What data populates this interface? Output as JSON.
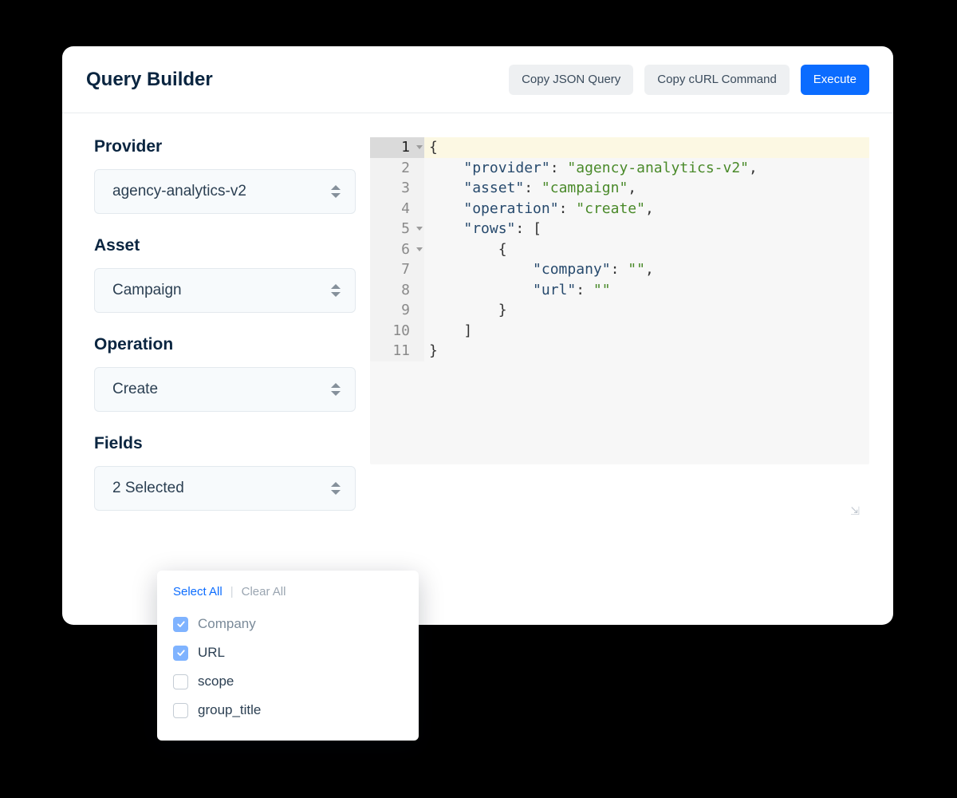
{
  "header": {
    "title": "Query Builder",
    "copy_json": "Copy JSON Query",
    "copy_curl": "Copy cURL Command",
    "execute": "Execute"
  },
  "form": {
    "provider_label": "Provider",
    "provider_value": "agency-analytics-v2",
    "asset_label": "Asset",
    "asset_value": "Campaign",
    "operation_label": "Operation",
    "operation_value": "Create",
    "fields_label": "Fields",
    "fields_value": "2 Selected"
  },
  "dropdown": {
    "select_all": "Select All",
    "clear_all": "Clear All",
    "options": [
      {
        "label": "Company",
        "checked": true,
        "muted": true
      },
      {
        "label": "URL",
        "checked": true,
        "muted": false
      },
      {
        "label": "scope",
        "checked": false,
        "muted": false
      },
      {
        "label": "group_title",
        "checked": false,
        "muted": false
      }
    ]
  },
  "editor": {
    "lines": [
      {
        "n": "1",
        "fold": true,
        "active": true,
        "tokens": [
          [
            "p",
            "{"
          ]
        ]
      },
      {
        "n": "2",
        "fold": false,
        "tokens": [
          [
            "ws",
            "    "
          ],
          [
            "key",
            "\"provider\""
          ],
          [
            "colon",
            ": "
          ],
          [
            "str",
            "\"agency-analytics-v2\""
          ],
          [
            "p",
            ","
          ]
        ]
      },
      {
        "n": "3",
        "fold": false,
        "tokens": [
          [
            "ws",
            "    "
          ],
          [
            "key",
            "\"asset\""
          ],
          [
            "colon",
            ": "
          ],
          [
            "str",
            "\"campaign\""
          ],
          [
            "p",
            ","
          ]
        ]
      },
      {
        "n": "4",
        "fold": false,
        "tokens": [
          [
            "ws",
            "    "
          ],
          [
            "key",
            "\"operation\""
          ],
          [
            "colon",
            ": "
          ],
          [
            "str",
            "\"create\""
          ],
          [
            "p",
            ","
          ]
        ]
      },
      {
        "n": "5",
        "fold": true,
        "tokens": [
          [
            "ws",
            "    "
          ],
          [
            "key",
            "\"rows\""
          ],
          [
            "colon",
            ": "
          ],
          [
            "p",
            "["
          ]
        ]
      },
      {
        "n": "6",
        "fold": true,
        "tokens": [
          [
            "ws",
            "        "
          ],
          [
            "p",
            "{"
          ]
        ]
      },
      {
        "n": "7",
        "fold": false,
        "tokens": [
          [
            "ws",
            "            "
          ],
          [
            "key",
            "\"company\""
          ],
          [
            "colon",
            ": "
          ],
          [
            "str",
            "\"\""
          ],
          [
            "p",
            ","
          ]
        ]
      },
      {
        "n": "8",
        "fold": false,
        "tokens": [
          [
            "ws",
            "            "
          ],
          [
            "key",
            "\"url\""
          ],
          [
            "colon",
            ": "
          ],
          [
            "str",
            "\"\""
          ]
        ]
      },
      {
        "n": "9",
        "fold": false,
        "tokens": [
          [
            "ws",
            "        "
          ],
          [
            "p",
            "}"
          ]
        ]
      },
      {
        "n": "10",
        "fold": false,
        "tokens": [
          [
            "ws",
            "    "
          ],
          [
            "p",
            "]"
          ]
        ]
      },
      {
        "n": "11",
        "fold": false,
        "tokens": [
          [
            "p",
            "}"
          ]
        ]
      }
    ]
  }
}
